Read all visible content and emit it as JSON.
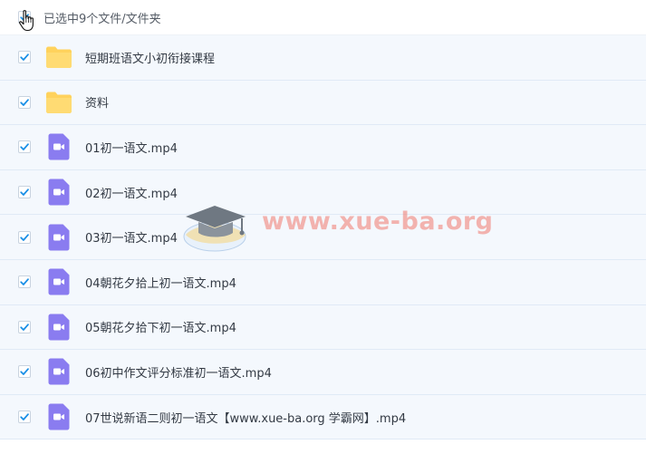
{
  "header": {
    "selection_text": "已选中9个文件/文件夹"
  },
  "files": [
    {
      "name": "短期班语文小初衔接课程",
      "type": "folder"
    },
    {
      "name": "资料",
      "type": "folder"
    },
    {
      "name": "01初一语文.mp4",
      "type": "video"
    },
    {
      "name": "02初一语文.mp4",
      "type": "video"
    },
    {
      "name": "03初一语文.mp4",
      "type": "video"
    },
    {
      "name": "04朝花夕拾上初一语文.mp4",
      "type": "video"
    },
    {
      "name": "05朝花夕拾下初一语文.mp4",
      "type": "video"
    },
    {
      "name": "06初中作文评分标准初一语文.mp4",
      "type": "video"
    },
    {
      "name": "07世说新语二则初一语文【www.xue-ba.org 学霸网】.mp4",
      "type": "video"
    }
  ],
  "watermark": {
    "text": "www.xue-ba.org"
  },
  "colors": {
    "checkbox": "#1a8fe6",
    "folder": "#ffd25c",
    "video": "#8a7cf0",
    "row_bg": "#f4f8fd"
  },
  "icons": {
    "folder": "folder-icon",
    "video": "video-file-icon",
    "check": "checkmark-icon",
    "cursor": "hand-cursor-icon",
    "watermark_logo": "graduation-cap-icon"
  }
}
